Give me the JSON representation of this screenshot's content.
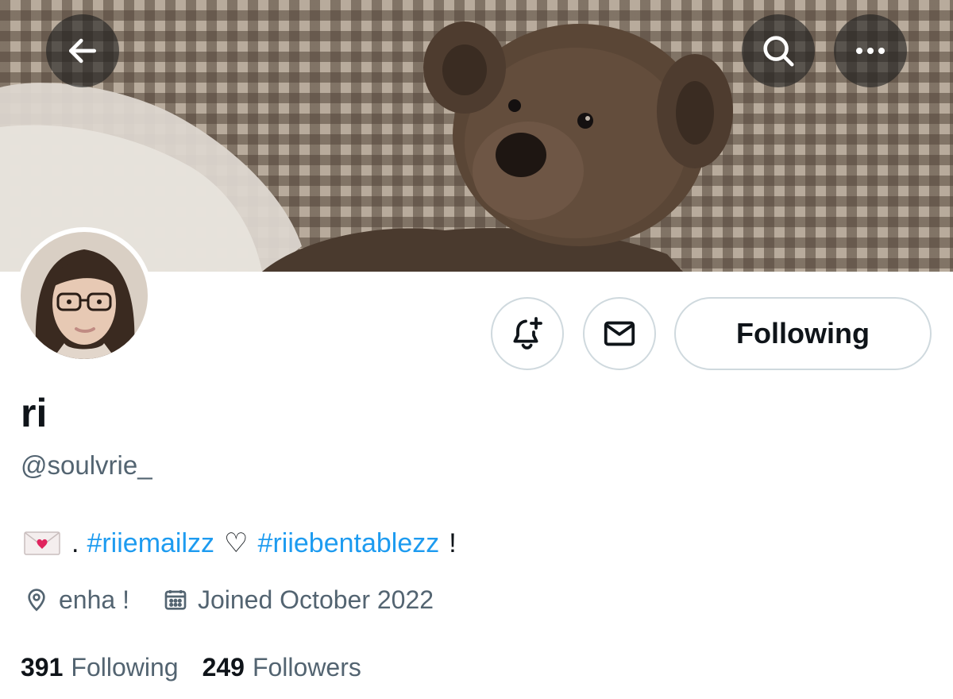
{
  "header": {
    "back_icon": "arrow-left-icon",
    "search_icon": "search-icon",
    "more_icon": "more-horizontal-icon"
  },
  "banner": {
    "description_icon": "banner-image"
  },
  "profile": {
    "display_name": "ri",
    "handle": "@soulvrie_",
    "bio": {
      "emoji_icon": "love-letter-envelope-icon",
      "separator": ".",
      "hashtag1": "#riiemailzz",
      "heart": "♡",
      "hashtag2": "#riiebentablezz",
      "suffix": "!"
    },
    "location": "enha !",
    "joined": "Joined October 2022",
    "following_count": "391",
    "following_label": "Following",
    "followers_count": "249",
    "followers_label": "Followers"
  },
  "actions": {
    "notify_icon": "bell-plus-icon",
    "message_icon": "envelope-icon",
    "follow_button": "Following"
  },
  "colors": {
    "accent": "#1d9bf0",
    "secondary_text": "#536471",
    "primary_text": "#0f1419",
    "border": "#cfd9de"
  }
}
